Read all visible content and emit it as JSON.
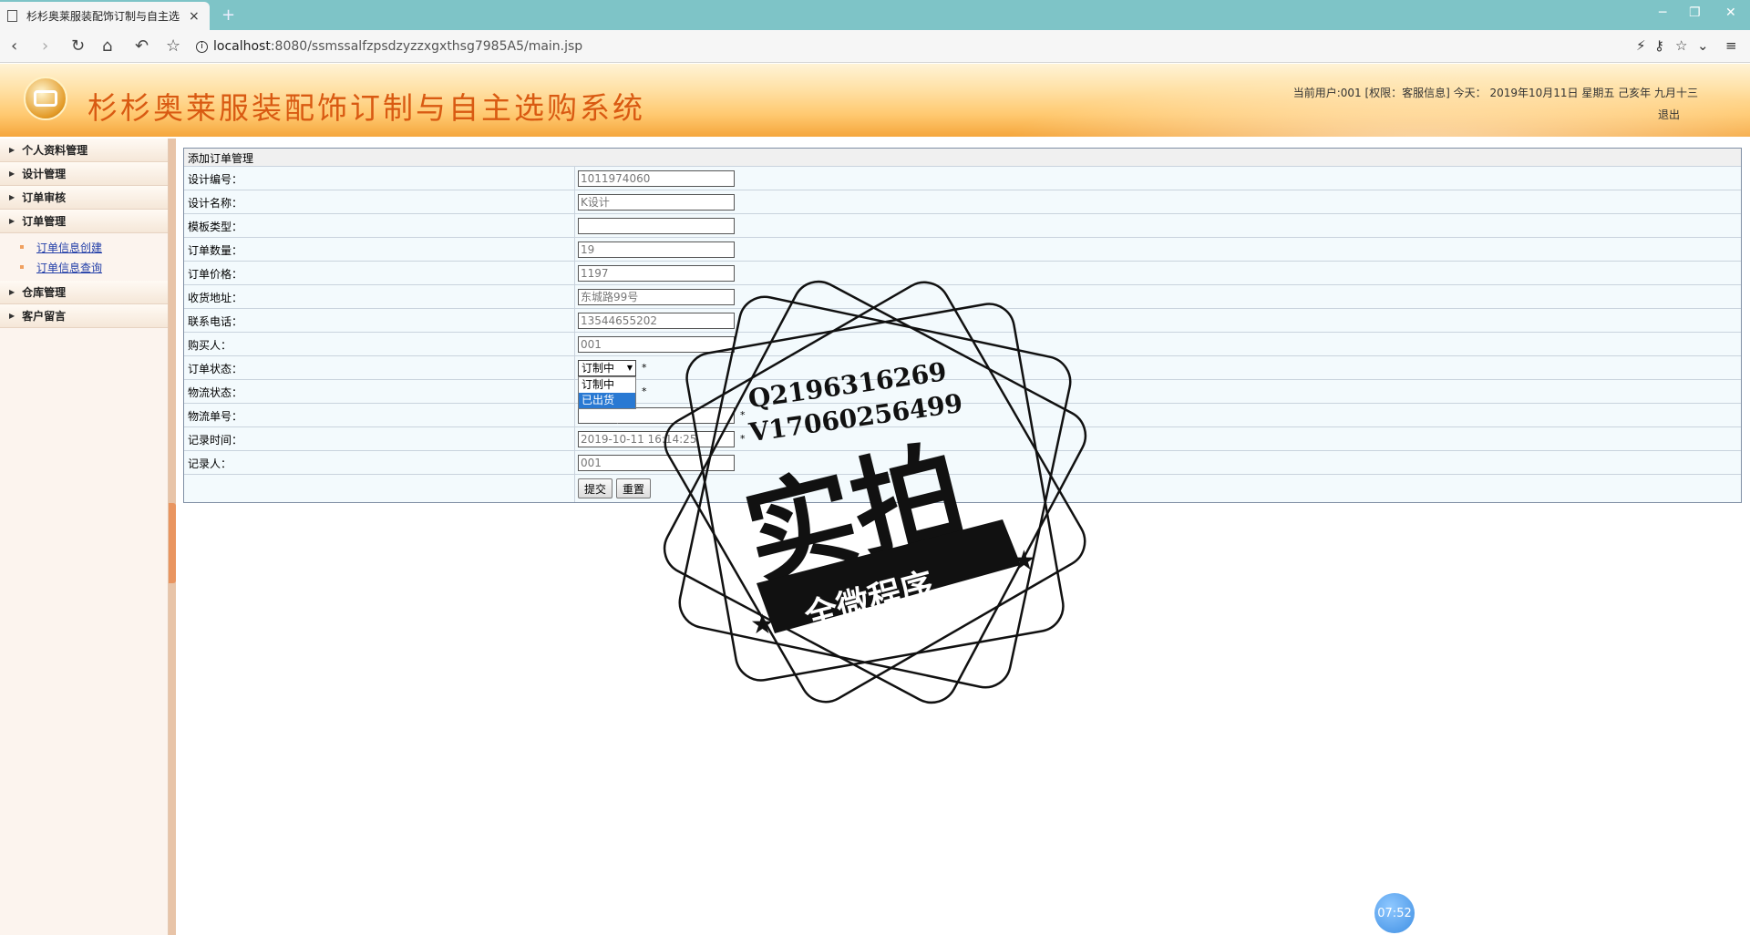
{
  "browser": {
    "tab_title": "杉杉奥莱服装配饰订制与自主选",
    "tab_close": "×",
    "new_tab": "+",
    "url_host": "localhost",
    "url_rest": ":8080/ssmssalfzpsdzyzzxgxthsg7985A5/main.jsp",
    "win_min": "─",
    "win_restore": "❐",
    "win_close": "✕"
  },
  "header": {
    "title": "杉杉奥莱服装配饰订制与自主选购系统",
    "user_info": "当前用户:001 [权限：客服信息] 今天： 2019年10月11日 星期五 己亥年 九月十三",
    "logout": "退出"
  },
  "sidebar": {
    "items": [
      {
        "label": "个人资料管理"
      },
      {
        "label": "设计管理"
      },
      {
        "label": "订单审核"
      },
      {
        "label": "订单管理"
      },
      {
        "label": "仓库管理"
      },
      {
        "label": "客户留言"
      }
    ],
    "sub_items": [
      {
        "label": "订单信息创建"
      },
      {
        "label": "订单信息查询"
      }
    ]
  },
  "form": {
    "title": "添加订单管理",
    "fields": [
      {
        "label": "设计编号：",
        "value": "1011974060"
      },
      {
        "label": "设计名称：",
        "value": "K设计"
      },
      {
        "label": "模板类型：",
        "value": ""
      },
      {
        "label": "订单数量：",
        "value": "19"
      },
      {
        "label": "订单价格：",
        "value": "1197"
      },
      {
        "label": "收货地址：",
        "value": "东城路99号"
      },
      {
        "label": "联系电话：",
        "value": "13544655202"
      },
      {
        "label": "购买人：",
        "value": "001"
      },
      {
        "label": "订单状态：",
        "value": "订制中"
      },
      {
        "label": "物流状态：",
        "value": ""
      },
      {
        "label": "物流单号：",
        "value": ""
      },
      {
        "label": "记录时间：",
        "value": "2019-10-11 16:14:25"
      },
      {
        "label": "记录人：",
        "value": "001"
      }
    ],
    "required_mark": "*",
    "status_options": [
      "订制中",
      "已出货"
    ],
    "submit": "提交",
    "reset": "重置"
  },
  "watermark": {
    "qq": "Q2196316269",
    "vx": "V17060256499",
    "main": "实拍",
    "banner": "全微程序"
  },
  "timer": "07:52"
}
